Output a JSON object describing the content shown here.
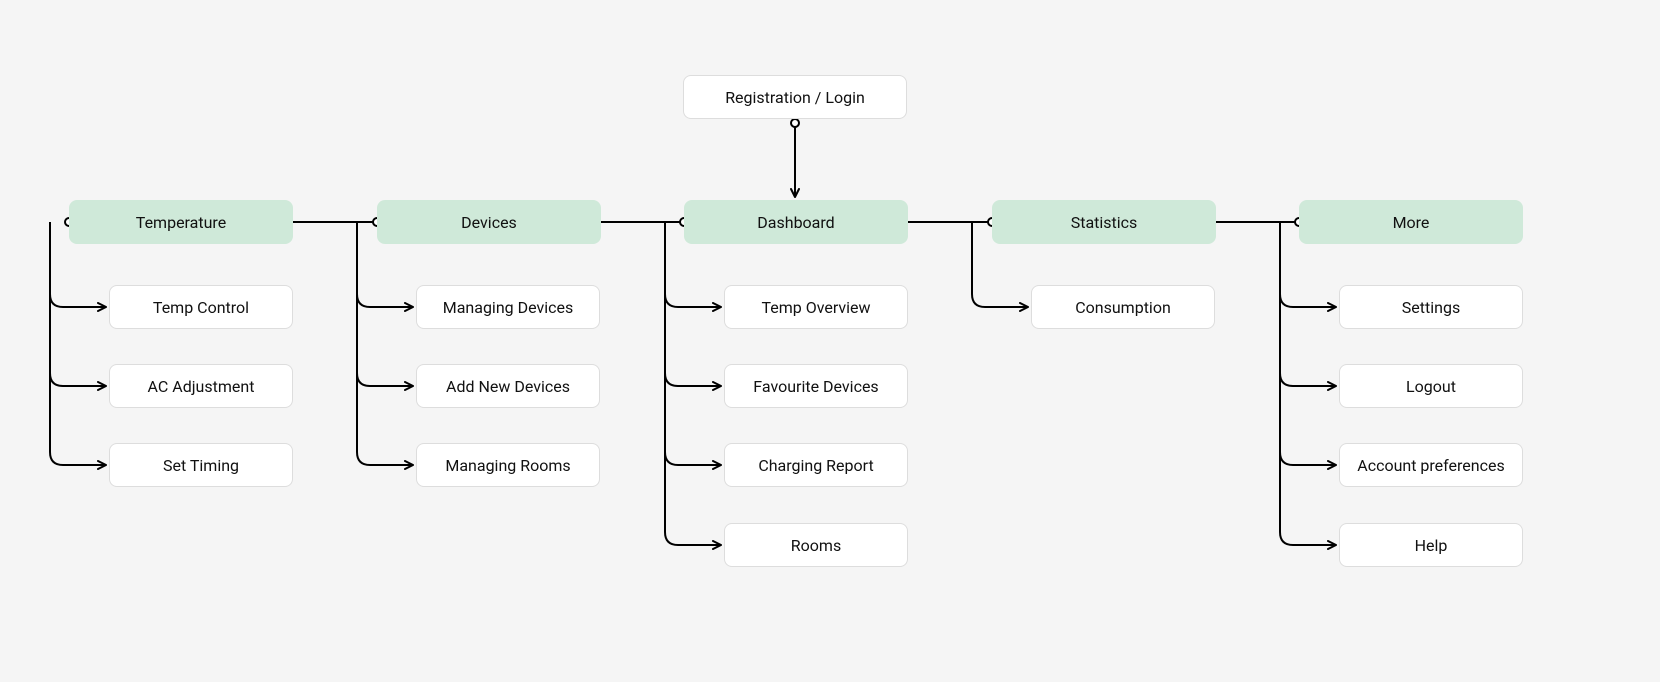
{
  "root": {
    "label": "Registration / Login"
  },
  "categories": [
    {
      "key": "temperature",
      "label": "Temperature",
      "children": [
        "Temp Control",
        "AC Adjustment",
        "Set Timing"
      ]
    },
    {
      "key": "devices",
      "label": "Devices",
      "children": [
        "Managing Devices",
        "Add New Devices",
        "Managing Rooms"
      ]
    },
    {
      "key": "dashboard",
      "label": "Dashboard",
      "children": [
        "Temp Overview",
        "Favourite Devices",
        "Charging Report",
        "Rooms"
      ]
    },
    {
      "key": "statistics",
      "label": "Statistics",
      "children": [
        "Consumption"
      ]
    },
    {
      "key": "more",
      "label": "More",
      "children": [
        "Settings",
        "Logout",
        "Account preferences",
        "Help"
      ]
    }
  ],
  "colors": {
    "category_bg": "#cfe9d9",
    "page_bg": "#f5f5f5",
    "node_bg": "#ffffff",
    "border": "#dddddd",
    "line": "#000000"
  }
}
